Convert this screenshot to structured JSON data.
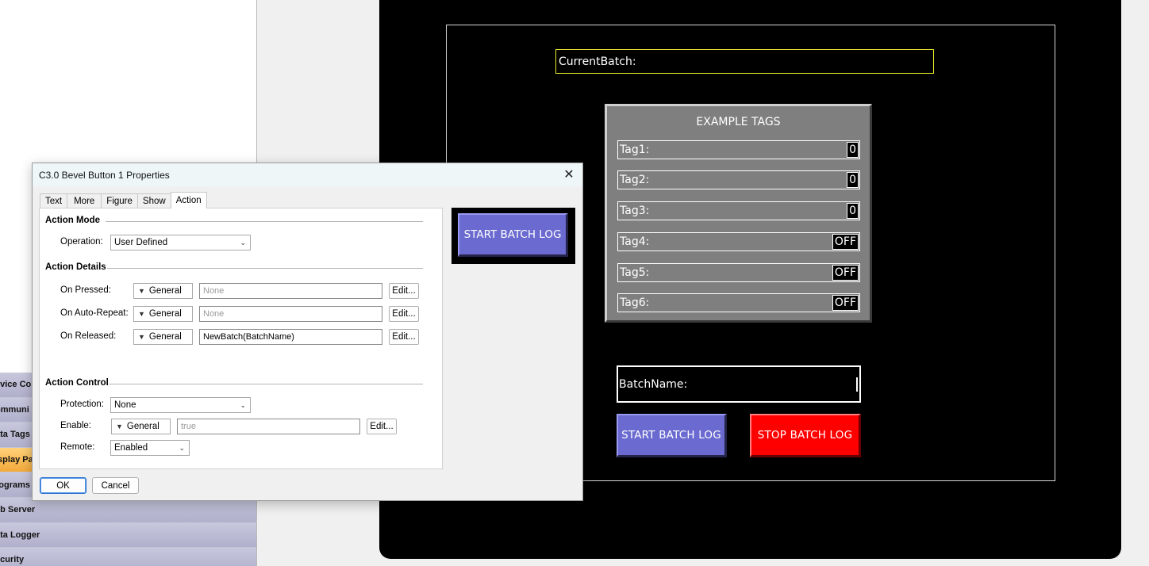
{
  "sidebar": {
    "items": [
      {
        "label": "evice Co",
        "active": false
      },
      {
        "label": "ommuni",
        "active": false
      },
      {
        "label": "ata Tags",
        "active": false
      },
      {
        "label": "isplay Pa",
        "active": true
      },
      {
        "label": "rograms",
        "active": false
      },
      {
        "label": "eb Server",
        "active": false
      },
      {
        "label": "ata Logger",
        "active": false
      },
      {
        "label": "ecurity",
        "active": false
      }
    ]
  },
  "hmi": {
    "current_batch_label": "CurrentBatch:",
    "panel_title": "EXAMPLE TAGS",
    "tags": [
      {
        "label": "Tag1:",
        "value": "0"
      },
      {
        "label": "Tag2:",
        "value": "0"
      },
      {
        "label": "Tag3:",
        "value": "0"
      },
      {
        "label": "Tag4:",
        "value": "OFF"
      },
      {
        "label": "Tag5:",
        "value": "OFF"
      },
      {
        "label": "Tag6:",
        "value": "OFF"
      }
    ],
    "batch_name_label": "BatchName:",
    "start_button": "START BATCH LOG",
    "stop_button": "STOP BATCH LOG",
    "colors": {
      "start": "#6a6ad0",
      "stop": "#ff0000",
      "batch_outline": "#e8e82a"
    }
  },
  "dialog": {
    "title": "C3.0 Bevel Button 1 Properties",
    "close_glyph": "✕",
    "tabs": [
      {
        "label": "Text",
        "active": false
      },
      {
        "label": "More",
        "active": false
      },
      {
        "label": "Figure",
        "active": false
      },
      {
        "label": "Show",
        "active": false
      },
      {
        "label": "Action",
        "active": true
      }
    ],
    "action_mode": {
      "title": "Action Mode",
      "operation_label": "Operation:",
      "operation_value": "User Defined"
    },
    "action_details": {
      "title": "Action Details",
      "rows": [
        {
          "label": "On Pressed:",
          "type": "General",
          "value": "None",
          "placeholder": true,
          "edit": "Edit..."
        },
        {
          "label": "On Auto-Repeat:",
          "type": "General",
          "value": "None",
          "placeholder": true,
          "edit": "Edit..."
        },
        {
          "label": "On Released:",
          "type": "General",
          "value": "NewBatch(BatchName)",
          "placeholder": false,
          "edit": "Edit..."
        }
      ]
    },
    "action_control": {
      "title": "Action Control",
      "protection_label": "Protection:",
      "protection_value": "None",
      "enable_label": "Enable:",
      "enable_type": "General",
      "enable_value": "true",
      "enable_edit": "Edit...",
      "remote_label": "Remote:",
      "remote_value": "Enabled"
    },
    "preview_label": "START BATCH LOG",
    "ok": "OK",
    "cancel": "Cancel"
  }
}
